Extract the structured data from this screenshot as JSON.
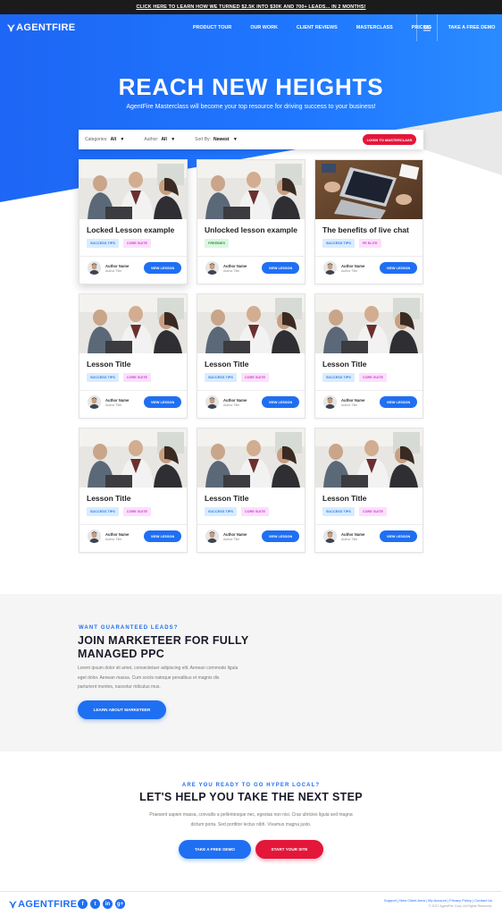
{
  "topbar": {
    "text": "CLICK HERE TO LEARN HOW WE TURNED $2.5K INTO $30K AND 700+ LEADS... IN 2 MONTHS!"
  },
  "nav": {
    "logo": "AGENTFIRE",
    "links": [
      "PRODUCT TOUR",
      "OUR WORK",
      "CLIENT REVIEWS",
      "MASTERCLASS",
      "PRICING"
    ],
    "cta": "TAKE A FREE DEMO"
  },
  "hero": {
    "title": "REACH NEW HEIGHTS",
    "subtitle": "AgentFire Masterclass will become your top resource for driving success to your business!"
  },
  "filters": {
    "categories_label": "Categories:",
    "categories_value": "All",
    "author_label": "Author:",
    "author_value": "All",
    "sort_label": "Sort By:",
    "sort_value": "Newest",
    "login_button": "LOGIN TO MASTERCLASS"
  },
  "colors": {
    "brand_blue": "#1f6ff2",
    "brand_red": "#e4163a",
    "dark": "#1b1b1b"
  },
  "cards": [
    {
      "title": "Locked Lesson example",
      "tags": [
        {
          "label": "SUCCESS TIPS",
          "color": "blue"
        },
        {
          "label": "CORE SUITE",
          "color": "pink"
        }
      ],
      "author": "Author Name",
      "author_title": "Author Title",
      "button": "VIEW LESSON",
      "image": "office-meeting"
    },
    {
      "title": "Unlocked lesson example",
      "tags": [
        {
          "label": "FREEBIES",
          "color": "green"
        }
      ],
      "author": "Author Name",
      "author_title": "Author Title",
      "button": "VIEW LESSON",
      "image": "office-meeting"
    },
    {
      "title": "The benefits of live chat",
      "tags": [
        {
          "label": "SUCCESS TIPS",
          "color": "blue"
        },
        {
          "label": "FE ELITE",
          "color": "pink"
        }
      ],
      "author": "Author Name",
      "author_title": "Author Title",
      "button": "VIEW LESSON",
      "image": "laptop-desk"
    },
    {
      "title": "Lesson Title",
      "tags": [
        {
          "label": "SUCCESS TIPS",
          "color": "blue"
        },
        {
          "label": "CORE SUITE",
          "color": "pink"
        }
      ],
      "author": "Author Name",
      "author_title": "Author Title",
      "button": "VIEW LESSON",
      "image": "office-meeting"
    },
    {
      "title": "Lesson Title",
      "tags": [
        {
          "label": "SUCCESS TIPS",
          "color": "blue"
        },
        {
          "label": "CORE SUITE",
          "color": "pink"
        }
      ],
      "author": "Author Name",
      "author_title": "Author Title",
      "button": "VIEW LESSON",
      "image": "office-meeting"
    },
    {
      "title": "Lesson Title",
      "tags": [
        {
          "label": "SUCCESS TIPS",
          "color": "blue"
        },
        {
          "label": "CORE SUITE",
          "color": "pink"
        }
      ],
      "author": "Author Name",
      "author_title": "Author Title",
      "button": "VIEW LESSON",
      "image": "office-meeting"
    },
    {
      "title": "Lesson Title",
      "tags": [
        {
          "label": "SUCCESS TIPS",
          "color": "blue"
        },
        {
          "label": "CORE SUITE",
          "color": "pink"
        }
      ],
      "author": "Author Name",
      "author_title": "Author Title",
      "button": "VIEW LESSON",
      "image": "office-meeting"
    },
    {
      "title": "Lesson Title",
      "tags": [
        {
          "label": "SUCCESS TIPS",
          "color": "blue"
        },
        {
          "label": "CORE SUITE",
          "color": "pink"
        }
      ],
      "author": "Author Name",
      "author_title": "Author Title",
      "button": "VIEW LESSON",
      "image": "office-meeting"
    },
    {
      "title": "Lesson Title",
      "tags": [
        {
          "label": "SUCCESS TIPS",
          "color": "blue"
        },
        {
          "label": "CORE SUITE",
          "color": "pink"
        }
      ],
      "author": "Author Name",
      "author_title": "Author Title",
      "button": "VIEW LESSON",
      "image": "office-meeting"
    }
  ],
  "marketeer": {
    "eyebrow": "WANT GUARANTEED LEADS?",
    "title": "JOIN MARKETEER FOR FULLY MANAGED PPC",
    "body": "Lorem ipsum dolor sit amet, consectetuer adipiscing elit. Aenean commodo ligula eget dolor. Aenean massa. Cum sociis natoque penatibus et magnis dis parturient montes, nascetur ridiculus mus.",
    "button": "LEARN ABOUT MARKETEER"
  },
  "cta": {
    "eyebrow": "ARE YOU READY TO GO HYPER LOCAL?",
    "title": "LET'S HELP YOU TAKE THE NEXT STEP",
    "body": "Praesent sapien massa, convallis a pellentesque nec, egestas non nisi. Cras ultricies ligula sed magna dictum porta. Sed porttitor lectus nibh. Vivamus magna justo.",
    "button_demo": "TAKE A FREE DEMO",
    "button_site": "START YOUR SITE"
  },
  "footer": {
    "logo": "AGENTFIRE",
    "social": [
      "facebook-icon",
      "twitter-icon",
      "linkedin-icon",
      "googleplus-icon"
    ],
    "social_glyphs": [
      "f",
      "t",
      "in",
      "g+"
    ],
    "links": "Support | New Client Area | My Account | Privacy Policy | Contact Us",
    "copyright": "© 2017 AgentFire Corp. All Rights Reserved."
  }
}
